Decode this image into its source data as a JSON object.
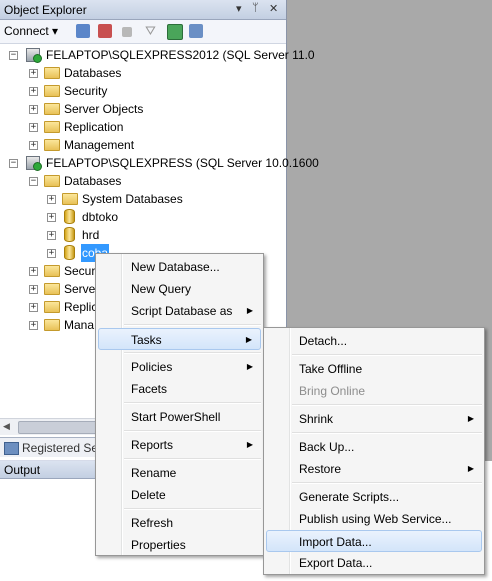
{
  "object_explorer": {
    "title": "Object Explorer",
    "pin_icon": "pin-icon",
    "dropdown_icon": "dropdown-icon",
    "close_icon": "close-icon",
    "toolbar": {
      "connect_label": "Connect ▾"
    },
    "tree": {
      "server1": {
        "label": "FELAPTOP\\SQLEXPRESS2012 (SQL Server 11.0",
        "children": [
          "Databases",
          "Security",
          "Server Objects",
          "Replication",
          "Management"
        ]
      },
      "server2": {
        "label": "FELAPTOP\\SQLEXPRESS (SQL Server 10.0.1600",
        "databases_label": "Databases",
        "db_children": [
          "System Databases",
          "dbtoko",
          "hrd",
          "coba"
        ],
        "children_partial": [
          "Secur",
          "Server",
          "Replic",
          "Mana"
        ]
      }
    }
  },
  "registered_servers": {
    "label": "Registered Ser"
  },
  "output": {
    "title": "Output"
  },
  "context_menu": {
    "items": [
      "New Database...",
      "New Query",
      "Script Database as",
      "Tasks",
      "Policies",
      "Facets",
      "Start PowerShell",
      "Reports",
      "Rename",
      "Delete",
      "Refresh",
      "Properties"
    ]
  },
  "tasks_submenu": {
    "items": [
      "Detach...",
      "Take Offline",
      "Bring Online",
      "Shrink",
      "Back Up...",
      "Restore",
      "Generate Scripts...",
      "Publish using Web Service...",
      "Import Data...",
      "Export Data..."
    ]
  },
  "colors": {
    "selection": "#3399ff",
    "menu_highlight": "#d3e5fa",
    "right_pane": "#a9a9a9"
  }
}
